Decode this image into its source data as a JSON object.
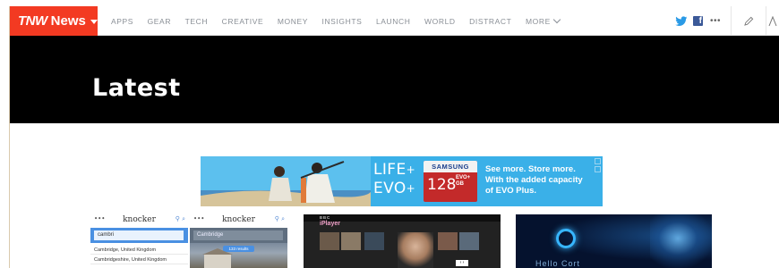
{
  "brand": {
    "logo_mark": "TNW",
    "logo_text": "News",
    "accent_color": "#f33a22"
  },
  "nav": {
    "items": [
      {
        "label": "APPS"
      },
      {
        "label": "GEAR"
      },
      {
        "label": "TECH"
      },
      {
        "label": "CREATIVE"
      },
      {
        "label": "MONEY"
      },
      {
        "label": "INSIGHTS"
      },
      {
        "label": "LAUNCH"
      },
      {
        "label": "WORLD"
      },
      {
        "label": "DISTRACT"
      }
    ],
    "more_label": "MORE",
    "icons": [
      "twitter-icon",
      "facebook-icon",
      "more-dots-icon",
      "pencil-icon",
      "user-icon"
    ]
  },
  "hero": {
    "title": "Latest"
  },
  "ad": {
    "life_line": "LIFE",
    "evo_line": "EVO",
    "plus_sign": "+",
    "card_brand": "SAMSUNG",
    "card_size": "128",
    "card_model": "EVO+",
    "card_unit": "GB",
    "copy_lines": [
      "See more. Store more.",
      "With the added capacity",
      "of EVO Plus."
    ],
    "bg_color": "#3ab0e8"
  },
  "articles": {
    "card1": {
      "app_name_left": "knocker",
      "app_name_right": "knocker",
      "search_value_left": "cambri",
      "search_value_right": "Cambridge",
      "results": [
        "Cambridge, United Kingdom",
        "Cambridgeshire, United Kingdom"
      ],
      "pill_label": "133 results"
    },
    "card2": {
      "logo": "iPlayer",
      "bbc": "BBC"
    },
    "card3": {
      "text": "Hello Cort"
    }
  }
}
